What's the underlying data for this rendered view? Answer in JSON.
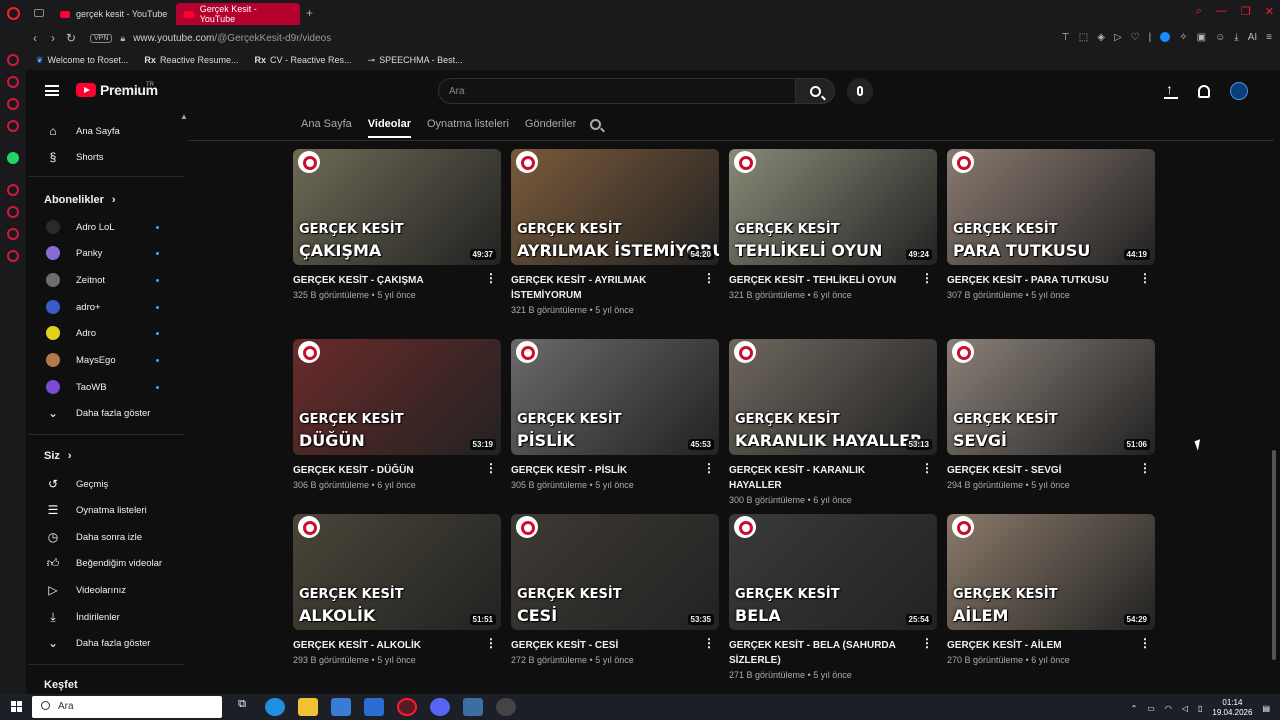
{
  "browser": {
    "tabs": [
      {
        "title": "gerçek kesit - YouTube"
      },
      {
        "title": "Gerçek Kesit - YouTube"
      }
    ],
    "vpn": "VPN",
    "url_host": "www.youtube.com",
    "url_path": "/@GerçekKesit-d9r/videos",
    "bookmarks": [
      "Welcome to Roset...",
      "Reactive Resume...",
      "CV - Reactive Res...",
      "SPEECHMA - Best..."
    ],
    "ai_label": "AI"
  },
  "masthead": {
    "brand": "Premium",
    "region": "TR",
    "search_placeholder": "Ara"
  },
  "sidebar": {
    "home": "Ana Sayfa",
    "shorts": "Shorts",
    "subs_heading": "Abonelikler",
    "channels": [
      {
        "name": "Adro LoL",
        "color": "#2a2a2a"
      },
      {
        "name": "Panky",
        "color": "#8a6cd6"
      },
      {
        "name": "Zeitnot",
        "color": "#6d6d6d"
      },
      {
        "name": "adro+",
        "color": "#3a5bc7"
      },
      {
        "name": "Adro",
        "color": "#e4d21a"
      },
      {
        "name": "MaysEgo",
        "color": "#b07a4a"
      },
      {
        "name": "TaoWB",
        "color": "#7a4ad6"
      }
    ],
    "show_more_1": "Daha fazla göster",
    "you_heading": "Siz",
    "you_items": [
      "Geçmiş",
      "Oynatma listeleri",
      "Daha sonra izle",
      "Beğendiğim videolar",
      "Videolarınız",
      "İndirilenler"
    ],
    "show_more_2": "Daha fazla göster",
    "explore": "Keşfet"
  },
  "channel_tabs": [
    "Ana Sayfa",
    "Videolar",
    "Oynatma listeleri",
    "Gönderiler"
  ],
  "videos": [
    {
      "ep": "ÇAKIŞMA",
      "dur": "49:37",
      "title": "GERÇEK KESİT - ÇAKIŞMA",
      "meta": "325 B görüntüleme • 5 yıl önce",
      "bg": "#6e6a55"
    },
    {
      "ep": "AYRILMAK İSTEMİYORUM",
      "dur": "54:20",
      "title": "GERÇEK KESİT - AYRILMAK İSTEMİYORUM",
      "meta": "321 B görüntüleme • 5 yıl önce",
      "bg": "#7a5a3a"
    },
    {
      "ep": "TEHLİKELİ OYUN",
      "dur": "49:24",
      "title": "GERÇEK KESİT - TEHLİKELİ OYUN",
      "meta": "321 B görüntüleme • 6 yıl önce",
      "bg": "#8a8a78"
    },
    {
      "ep": "PARA TUTKUSU",
      "dur": "44:19",
      "title": "GERÇEK KESİT - PARA TUTKUSU",
      "meta": "307 B görüntüleme • 5 yıl önce",
      "bg": "#8a7a70"
    },
    {
      "ep": "DÜĞÜN",
      "dur": "53:19",
      "title": "GERÇEK KESİT - DÜĞÜN",
      "meta": "306 B görüntüleme • 6 yıl önce",
      "bg": "#6a2a2a"
    },
    {
      "ep": "PİSLİK",
      "dur": "45:53",
      "title": "GERÇEK KESİT - PİSLİK",
      "meta": "305 B görüntüleme • 5 yıl önce",
      "bg": "#6a6a6a"
    },
    {
      "ep": "KARANLIK HAYALLER",
      "dur": "53:13",
      "title": "GERÇEK KESİT - KARANLIK HAYALLER",
      "meta": "300 B görüntüleme • 6 yıl önce",
      "bg": "#6e675e"
    },
    {
      "ep": "SEVGİ",
      "dur": "51:06",
      "title": "GERÇEK KESİT - SEVGİ",
      "meta": "294 B görüntüleme • 5 yıl önce",
      "bg": "#8a8078"
    },
    {
      "ep": "ALKOLİK",
      "dur": "51:51",
      "title": "GERÇEK KESİT -  ALKOLİK",
      "meta": "293 B görüntüleme • 5 yıl önce",
      "bg": "#4a4538"
    },
    {
      "ep": "CESİ",
      "dur": "53:35",
      "title": "GERÇEK KESİT - CESİ",
      "meta": "272 B görüntüleme • 5 yıl önce",
      "bg": "#3e3a34"
    },
    {
      "ep": "BELA",
      "dur": "25:54",
      "title": "GERÇEK KESİT - BELA  (SAHURDA SİZLERLE)",
      "meta": "271 B görüntüleme • 5 yıl önce",
      "bg": "#3a3a3a"
    },
    {
      "ep": "AİLEM",
      "dur": "54:29",
      "title": "GERÇEK KESİT - AİLEM",
      "meta": "270 B görüntüleme • 6 yıl önce",
      "bg": "#8a7a6a"
    }
  ],
  "video_brand": "GERÇEK KESİT",
  "taskbar": {
    "search_placeholder": "Ara",
    "time": "01:14",
    "date": "19.04.2026"
  }
}
